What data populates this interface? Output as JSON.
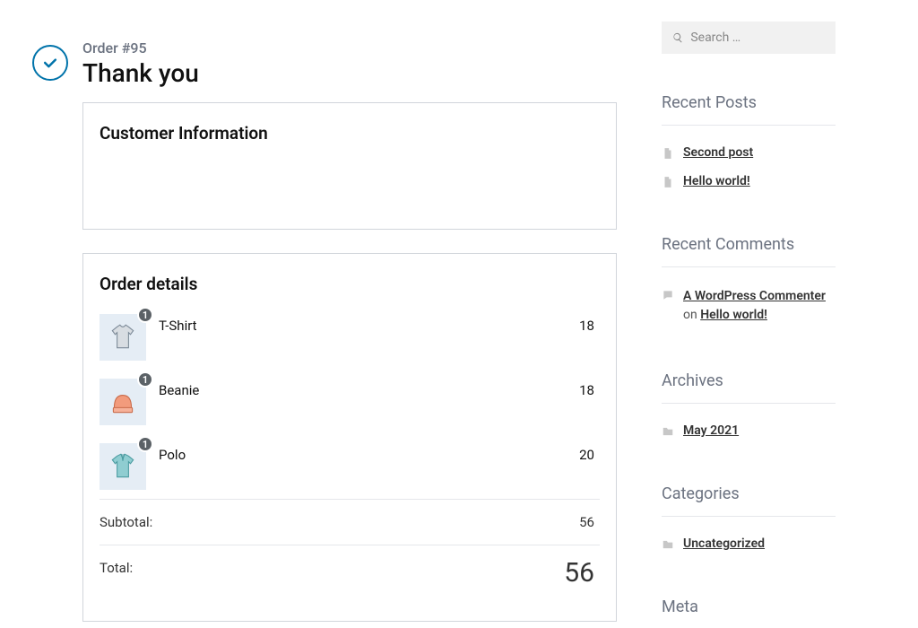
{
  "order": {
    "number_label": "Order #95",
    "thank_you": "Thank you",
    "customer_info_title": "Customer Information",
    "details_title": "Order details",
    "items": [
      {
        "name": "T-Shirt",
        "qty": "1",
        "price": "18"
      },
      {
        "name": "Beanie",
        "qty": "1",
        "price": "18"
      },
      {
        "name": "Polo",
        "qty": "1",
        "price": "20"
      }
    ],
    "subtotal_label": "Subtotal:",
    "subtotal_value": "56",
    "total_label": "Total:",
    "total_value": "56"
  },
  "search": {
    "placeholder": "Search …"
  },
  "widgets": {
    "recent_posts": {
      "title": "Recent Posts",
      "items": [
        "Second post",
        "Hello world!"
      ]
    },
    "recent_comments": {
      "title": "Recent Comments",
      "commenter": "A WordPress Commenter",
      "on": " on ",
      "post": "Hello world!"
    },
    "archives": {
      "title": "Archives",
      "items": [
        "May 2021"
      ]
    },
    "categories": {
      "title": "Categories",
      "items": [
        "Uncategorized"
      ]
    },
    "meta": {
      "title": "Meta"
    }
  }
}
